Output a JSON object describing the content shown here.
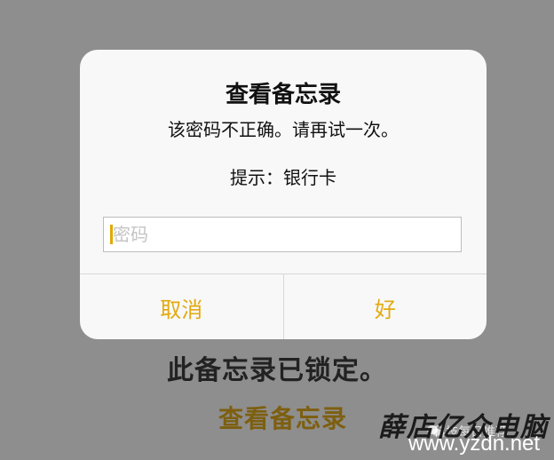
{
  "background": {
    "locked_message": "此备忘录已锁定。",
    "view_note_label": "查看备忘录"
  },
  "dialog": {
    "title": "查看备忘录",
    "message": "该密码不正确。请再试一次。",
    "hint": "提示：银行卡",
    "password_input": {
      "value": "",
      "placeholder": "密码"
    },
    "cancel_label": "取消",
    "ok_label": "好"
  },
  "watermark": {
    "brand": "薛店亿众电脑",
    "url": "www.yzdn.net",
    "overlay_text": "科技每日推荐"
  },
  "colors": {
    "accent": "#e3a90f",
    "dialog_background": "#f8f8f8",
    "backdrop": "#8e8e8e"
  }
}
